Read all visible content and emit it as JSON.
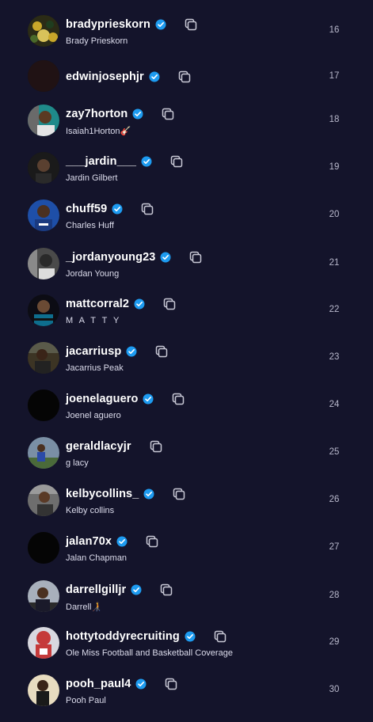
{
  "accounts": [
    {
      "username": "bradyprieskorn",
      "name": "Brady Prieskorn",
      "rank": "16",
      "avatar_color": "#3a3a1f"
    },
    {
      "username": "edwinjosephjr",
      "name": "",
      "rank": "17",
      "avatar_color": "#201214"
    },
    {
      "username": "zay7horton",
      "name": "Isaiah1Horton🎸",
      "rank": "18",
      "avatar_color": "#1f8a8a"
    },
    {
      "username": "___jardin___",
      "name": "Jardin Gilbert",
      "rank": "19",
      "avatar_color": "#1a1a1a"
    },
    {
      "username": "chuff59",
      "name": "Charles Huff",
      "rank": "20",
      "avatar_color": "#1e4fa8"
    },
    {
      "username": "_jordanyoung23",
      "name": "Jordan Young",
      "rank": "21",
      "avatar_color": "#4a4a4a"
    },
    {
      "username": "mattcorral2",
      "name": "M A T T Y",
      "rank": "22",
      "avatar_color": "#0e6e8e"
    },
    {
      "username": "jacarriusp",
      "name": "Jacarrius Peak",
      "rank": "23",
      "avatar_color": "#3c3424"
    },
    {
      "username": "joenelaguero",
      "name": "Joenel aguero",
      "rank": "24",
      "avatar_color": "#050505"
    },
    {
      "username": "geraldlacyjr",
      "name": "g lacy",
      "rank": "25",
      "avatar_color": "#7a8fa5"
    },
    {
      "username": "kelbycollins_",
      "name": "Kelby collins",
      "rank": "26",
      "avatar_color": "#6e6e6e"
    },
    {
      "username": "jalan70x",
      "name": "Jalan Chapman",
      "rank": "27",
      "avatar_color": "#050505"
    },
    {
      "username": "darrellgilljr",
      "name": "Darrell🧑‍🦯",
      "rank": "28",
      "avatar_color": "#a8b0bc"
    },
    {
      "username": "hottytoddyrecruiting",
      "name": "Ole Miss Football and Basketball Coverage",
      "rank": "29",
      "avatar_color": "#c53a3a"
    },
    {
      "username": "pooh_paul4",
      "name": "Pooh Paul",
      "rank": "30",
      "avatar_color": "#d9c9a8"
    }
  ],
  "colors": {
    "background": "#14142b",
    "verified": "#1d9bf0",
    "icon": "#c9c9d6"
  },
  "icons": {
    "verified": "verified-badge-icon",
    "copy": "copy-icon"
  }
}
